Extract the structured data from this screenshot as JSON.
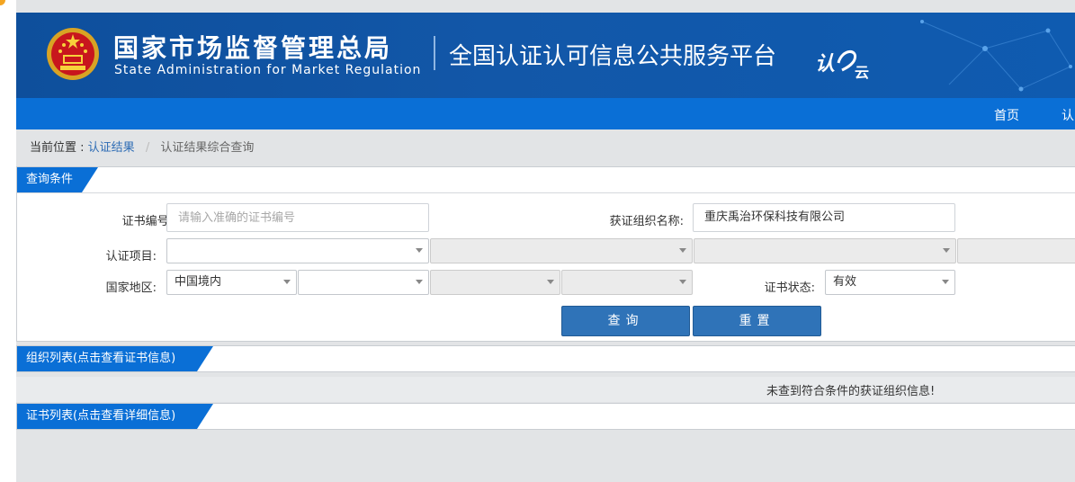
{
  "header": {
    "agency_cn": "国家市场监督管理总局",
    "agency_en": "State Administration  for  Market Regulation",
    "platform_title": "全国认证认可信息公共服务平台",
    "cloud_logo_text": "认云",
    "emblem_icon": "national-emblem-icon"
  },
  "nav": {
    "items": [
      {
        "label": "首页"
      },
      {
        "label": "认"
      }
    ]
  },
  "breadcrumb": {
    "prefix": "当前位置 :",
    "link": "认证结果",
    "separator": "/",
    "current": "认证结果综合查询"
  },
  "query_panel": {
    "title": "查询条件",
    "cert_no_label": "证书编号:",
    "cert_no_placeholder": "请输入准确的证书编号",
    "cert_no_value": "",
    "org_name_label": "获证组织名称:",
    "org_name_value": "重庆禹治环保科技有限公司",
    "project_label": "认证项目:",
    "project_selects": [
      "",
      "",
      "",
      ""
    ],
    "region_label": "国家地区:",
    "region_selects": [
      "中国境内",
      "",
      "",
      ""
    ],
    "status_label": "证书状态:",
    "status_value": "有效",
    "search_button": "查询",
    "reset_button": "重置"
  },
  "org_list": {
    "title": "组织列表(点击查看证书信息)",
    "empty_message": "未查到符合条件的获证组织信息!"
  },
  "cert_list": {
    "title": "证书列表(点击查看详细信息)"
  },
  "colors": {
    "banner": "#1257a8",
    "nav": "#0a6fd6",
    "button": "#2f73b8",
    "link": "#2f6db5"
  }
}
